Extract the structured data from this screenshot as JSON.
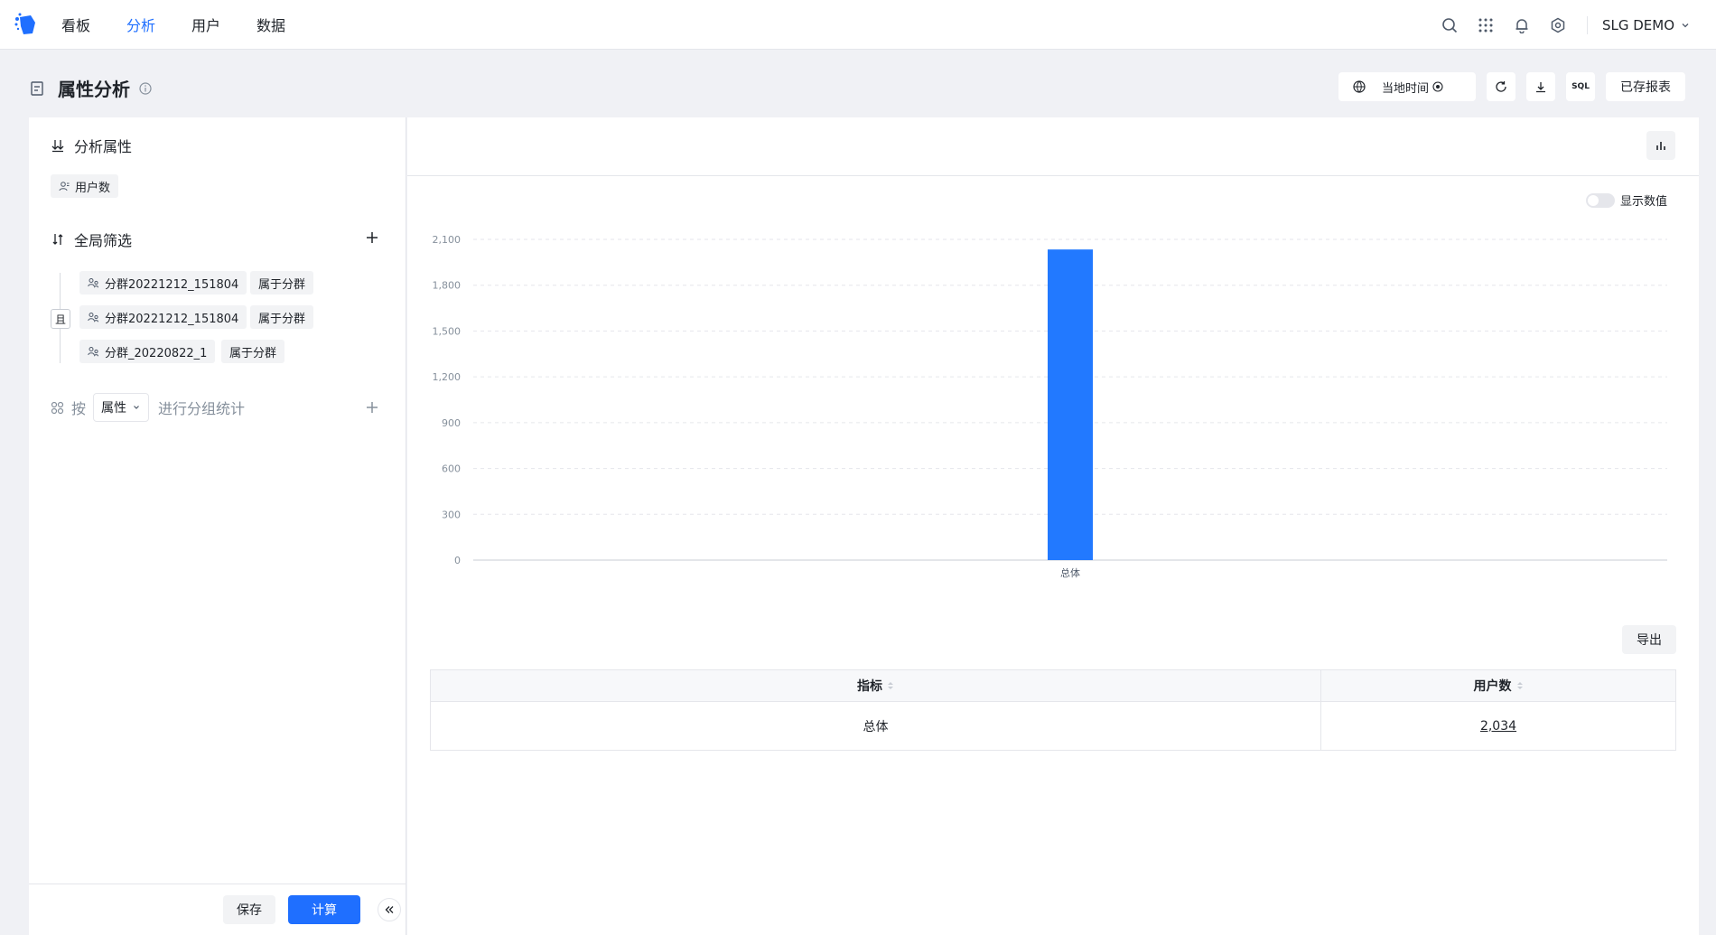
{
  "nav": {
    "items": [
      "看板",
      "分析",
      "用户",
      "数据"
    ],
    "active_index": 1,
    "account": "SLG DEMO"
  },
  "page": {
    "title": "属性分析",
    "time_label": "当地时间",
    "sql_label": "SQL",
    "saved_reports": "已存报表"
  },
  "left": {
    "analysis_title": "分析属性",
    "metric_chip": "用户数",
    "filter_title": "全局筛选",
    "logic": "且",
    "filters": [
      {
        "name": "分群20221212_151804",
        "op": "属于分群"
      },
      {
        "name": "分群20221212_151804",
        "op": "属于分群"
      },
      {
        "name": "分群_20220822_1",
        "op": "属于分群"
      }
    ],
    "group_prefix": "按",
    "group_select": "属性",
    "group_suffix": "进行分组统计",
    "save": "保存",
    "calculate": "计算"
  },
  "right": {
    "show_values": "显示数值",
    "export": "导出"
  },
  "chart_data": {
    "type": "bar",
    "categories": [
      "总体"
    ],
    "series": [
      {
        "values": [
          2034
        ]
      }
    ],
    "y_ticks": [
      "0",
      "300",
      "600",
      "900",
      "1,200",
      "1,500",
      "1,800",
      "2,100"
    ],
    "ylim": [
      0,
      2100
    ],
    "grid": true,
    "color": "#2279ff"
  },
  "table": {
    "headers": [
      "指标",
      "用户数"
    ],
    "rows": [
      [
        "总体",
        "2,034"
      ]
    ]
  }
}
